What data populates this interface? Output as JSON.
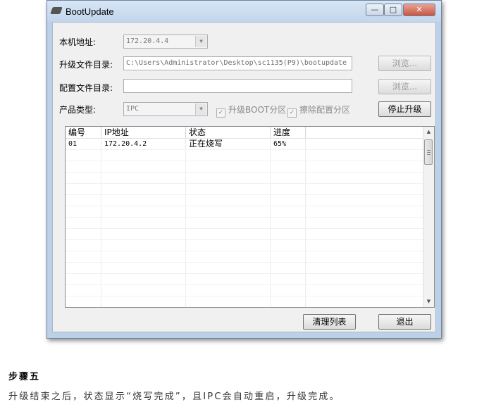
{
  "window": {
    "title": "BootUpdate",
    "controls": {
      "minimize": "—",
      "maximize": "□",
      "close": "✕"
    }
  },
  "form": {
    "local_address_label": "本机地址:",
    "local_address_value": "172.20.4.4",
    "upgrade_dir_label": "升级文件目录:",
    "upgrade_dir_value": "C:\\Users\\Administrator\\Desktop\\sc1135(P9)\\bootupdate",
    "config_dir_label": "配置文件目录:",
    "config_dir_value": "",
    "browse_label": "浏览...",
    "product_type_label": "产品类型:",
    "product_type_value": "IPC",
    "upgrade_boot_label": "升级BOOT分区",
    "erase_config_label": "擦除配置分区",
    "stop_upgrade_label": "停止升级"
  },
  "table": {
    "columns": [
      "编号",
      "IP地址",
      "状态",
      "进度"
    ],
    "rows": [
      {
        "id": "01",
        "ip": "172.20.4.2",
        "status": "正在烧写",
        "progress": "65%"
      }
    ]
  },
  "footer": {
    "clear_list_label": "清理列表",
    "exit_label": "退出"
  },
  "article": {
    "step_title": "步骤五",
    "step_text": "升级结束之后，状态显示“烧写完成”，且IPC会自动重启，升级完成。"
  }
}
